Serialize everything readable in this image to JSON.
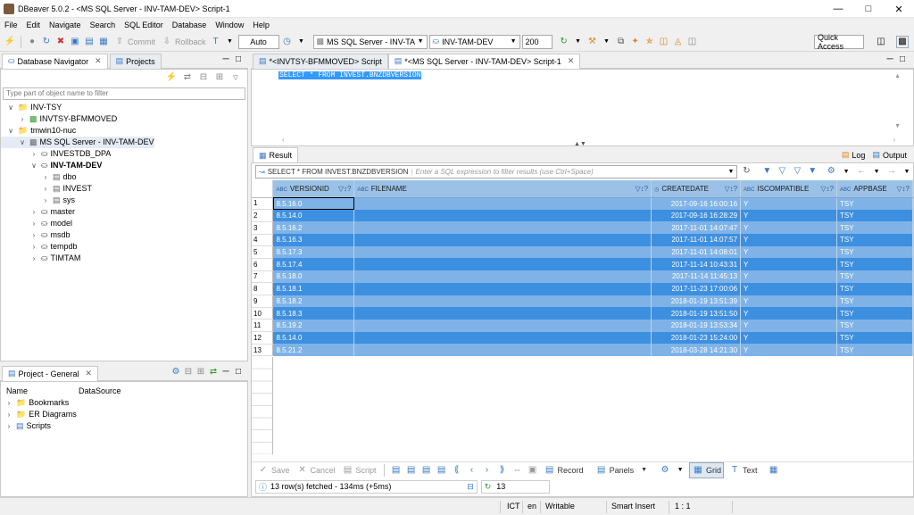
{
  "window": {
    "title": "DBeaver 5.0.2 - <MS SQL Server - INV-TAM-DEV> Script-1"
  },
  "menu": [
    "File",
    "Edit",
    "Navigate",
    "Search",
    "SQL Editor",
    "Database",
    "Window",
    "Help"
  ],
  "toolbar": {
    "commit": "Commit",
    "rollback": "Rollback",
    "transaction_mode": "Auto",
    "datasource": "MS SQL Server - INV-TAM",
    "database": "INV-TAM-DEV",
    "limit": "200",
    "quick_access": "Quick Access"
  },
  "navigator": {
    "tab_label": "Database Navigator",
    "projects_tab": "Projects",
    "filter_placeholder": "Type part of object name to filter",
    "tree": [
      {
        "label": "INV-TSY",
        "depth": 0,
        "icon": "folder-icon",
        "expanded": true
      },
      {
        "label": "INVTSY-BFMMOVED",
        "depth": 1,
        "icon": "connection-icon",
        "expanded": false
      },
      {
        "label": "tmwin10-nuc",
        "depth": 0,
        "icon": "folder-icon",
        "expanded": true
      },
      {
        "label": "MS SQL Server - INV-TAM-DEV",
        "depth": 1,
        "icon": "server-icon",
        "expanded": true,
        "selected": true
      },
      {
        "label": "INVESTDB_DPA",
        "depth": 2,
        "icon": "database-icon",
        "expanded": false
      },
      {
        "label": "INV-TAM-DEV",
        "depth": 2,
        "icon": "database-icon",
        "expanded": true,
        "bold": true
      },
      {
        "label": "dbo",
        "depth": 3,
        "icon": "schema-icon",
        "expanded": false
      },
      {
        "label": "INVEST",
        "depth": 3,
        "icon": "schema-icon",
        "expanded": false
      },
      {
        "label": "sys",
        "depth": 3,
        "icon": "schema-icon",
        "expanded": false
      },
      {
        "label": "master",
        "depth": 2,
        "icon": "database-icon",
        "expanded": false
      },
      {
        "label": "model",
        "depth": 2,
        "icon": "database-icon",
        "expanded": false
      },
      {
        "label": "msdb",
        "depth": 2,
        "icon": "database-icon",
        "expanded": false
      },
      {
        "label": "tempdb",
        "depth": 2,
        "icon": "database-icon",
        "expanded": false
      },
      {
        "label": "TIMTAM",
        "depth": 2,
        "icon": "database-icon",
        "expanded": false
      }
    ]
  },
  "project": {
    "tab_label": "Project - General",
    "col_name": "Name",
    "col_datasource": "DataSource",
    "items": [
      "Bookmarks",
      "ER Diagrams",
      "Scripts"
    ]
  },
  "editor": {
    "tabs": [
      "*<INVTSY-BFMMOVED> Script",
      "*<MS SQL Server - INV-TAM-DEV> Script-1"
    ],
    "sql": "SELECT * FROM INVEST.BNZDBVERSION"
  },
  "result": {
    "tab_label": "Result",
    "log_label": "Log",
    "output_label": "Output",
    "filter_query": "SELECT * FROM INVEST.BNZDBVERSION",
    "filter_placeholder": "Enter a SQL expression to filter results (use Ctrl+Space)",
    "columns": [
      "VERSIONID",
      "FILENAME",
      "CREATEDATE",
      "ISCOMPATIBLE",
      "APPBASE"
    ],
    "rows": [
      [
        "8.5.16.0",
        "",
        "2017-09-16 16:00:16",
        "Y",
        "TSY"
      ],
      [
        "8.5.14.0",
        "",
        "2017-09-16 16:28:29",
        "Y",
        "TSY"
      ],
      [
        "8.5.16.2",
        "",
        "2017-11-01 14:07:47",
        "Y",
        "TSY"
      ],
      [
        "8.5.16.3",
        "",
        "2017-11-01 14:07:57",
        "Y",
        "TSY"
      ],
      [
        "8.5.17.3",
        "",
        "2017-11-01 14:08:01",
        "Y",
        "TSY"
      ],
      [
        "8.5.17.4",
        "",
        "2017-11-14 10:43:31",
        "Y",
        "TSY"
      ],
      [
        "8.5.18.0",
        "",
        "2017-11-14 11:45:13",
        "Y",
        "TSY"
      ],
      [
        "8.5.18.1",
        "",
        "2017-11-23 17:00:06",
        "Y",
        "TSY"
      ],
      [
        "8.5.18.2",
        "",
        "2018-01-19 13:51:39",
        "Y",
        "TSY"
      ],
      [
        "8.5.18.3",
        "",
        "2018-01-19 13:51:50",
        "Y",
        "TSY"
      ],
      [
        "8.5.19.2",
        "",
        "2018-01-19 13:53:34",
        "Y",
        "TSY"
      ],
      [
        "8.5.14.0",
        "",
        "2018-01-23 15:24:00",
        "Y",
        "TSY"
      ],
      [
        "8.5.21.2",
        "",
        "2018-03-28 14:21:30",
        "Y",
        "TSY"
      ]
    ],
    "bottom": {
      "save": "Save",
      "cancel": "Cancel",
      "script": "Script",
      "record": "Record",
      "panels": "Panels",
      "grid": "Grid",
      "text": "Text"
    },
    "status_text": "13 row(s) fetched - 134ms (+5ms)",
    "row_count": "13"
  },
  "statusbar": {
    "tz": "ICT",
    "lang": "en",
    "mode": "Writable",
    "insert": "Smart Insert",
    "pos": "1 : 1"
  },
  "colors": {
    "row_light": "#7fb3e8",
    "row_dark": "#3d8fe0",
    "header": "#9bc2e6",
    "sql_highlight": "#3399ff"
  }
}
